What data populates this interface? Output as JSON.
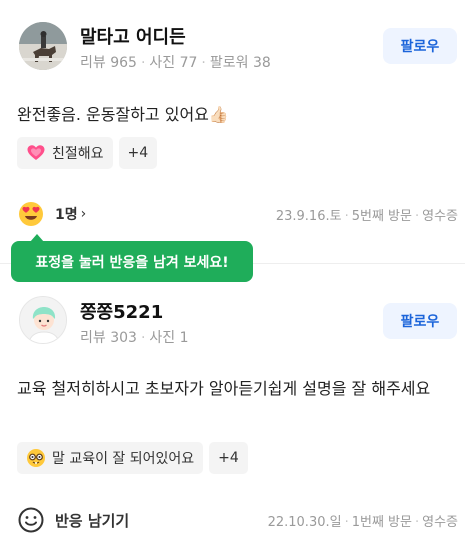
{
  "reviews": [
    {
      "user_name": "말타고 어디든",
      "stats": [
        "리뷰 965",
        "사진 77",
        "팔로워 38"
      ],
      "follow_label": "팔로우",
      "text": "완전좋음. 운동잘하고 있어요👍🏻",
      "tags": [
        "친절해요",
        "+4"
      ],
      "reaction_count": "1명",
      "meta": [
        "23.9.16.토",
        "5번째 방문",
        "영수증"
      ]
    },
    {
      "user_name": "쫑쫑5221",
      "stats": [
        "리뷰 303",
        "사진 1"
      ],
      "follow_label": "팔로우",
      "text": "교육 철저히하시고 초보자가 알아듣기쉽게 설명을 잘 해주세요",
      "tags": [
        "말 교육이 잘 되어있어요",
        "+4"
      ],
      "reaction_label": "반응 남기기",
      "meta": [
        "22.10.30.일",
        "1번째 방문",
        "영수증"
      ]
    }
  ],
  "tooltip": "표정을 눌러 반응을 남겨 보세요!",
  "icons": {
    "heart": "heart-icon",
    "heart_eyes": "heart-eyes-icon",
    "chevron": "chevron-right-icon",
    "smile": "smile-icon",
    "nerd": "nerd-face-icon"
  },
  "colors": {
    "accent": "#1b64da",
    "follow_bg": "#eef4ff",
    "tooltip_bg": "#1fad5a"
  }
}
